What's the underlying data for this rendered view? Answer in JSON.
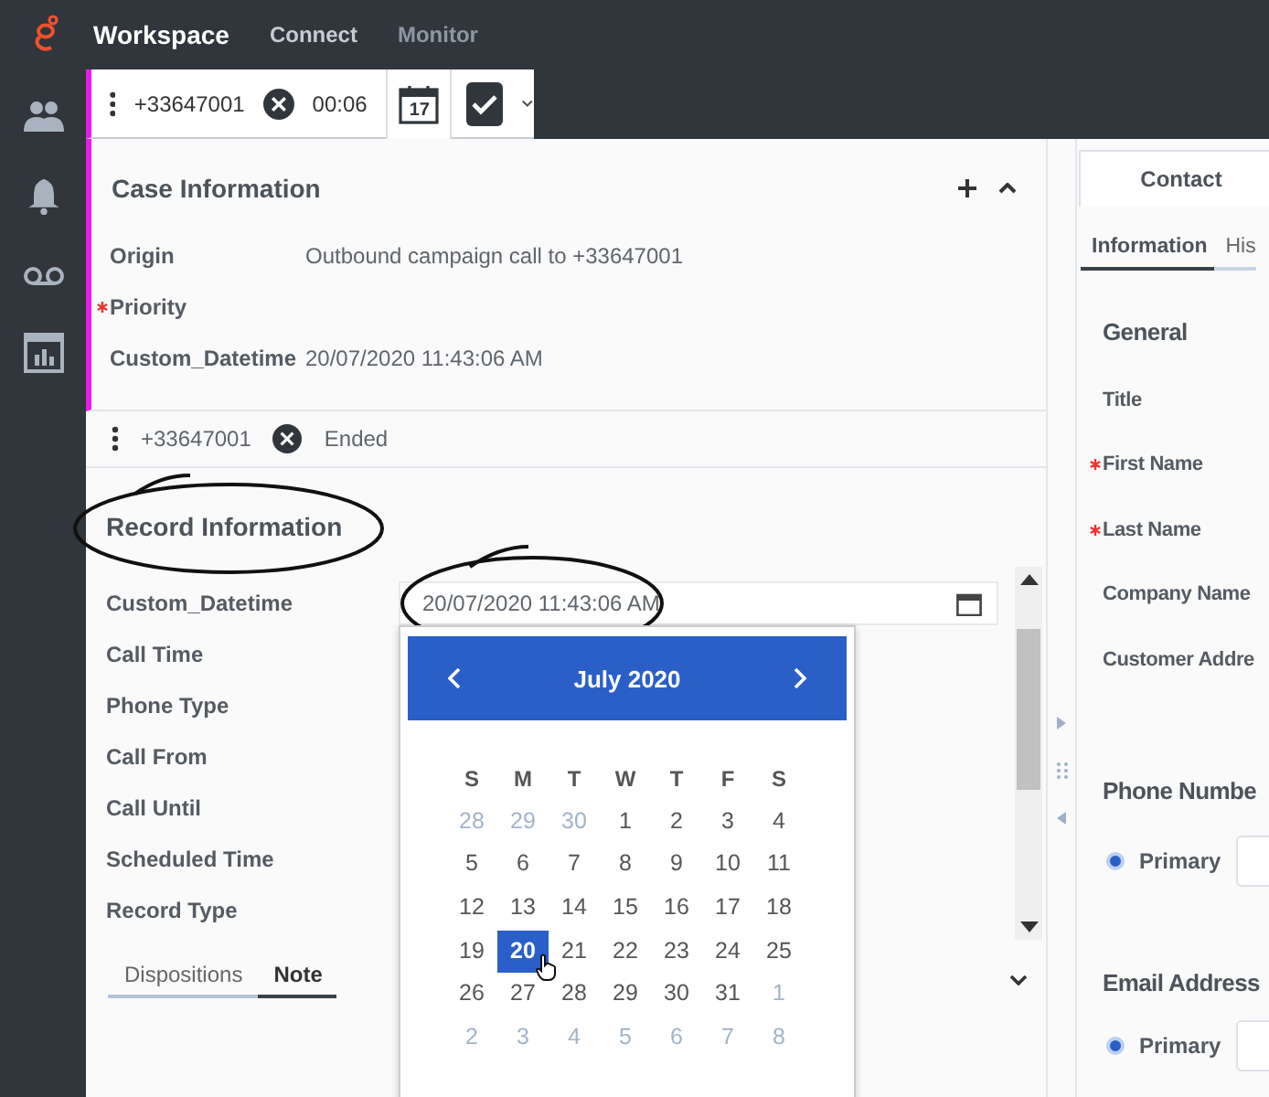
{
  "app": {
    "name": "Workspace",
    "nav": [
      {
        "label": "Connect",
        "selected": true
      },
      {
        "label": "Monitor",
        "selected": false
      }
    ]
  },
  "call_bar": {
    "number": "+33647001",
    "timer": "00:06",
    "calendar_day": "17"
  },
  "case_information": {
    "title": "Case Information",
    "fields": [
      {
        "label": "Origin",
        "value": "Outbound campaign call to +33647001",
        "required": false
      },
      {
        "label": "Priority",
        "required": true
      },
      {
        "label": "Custom_Datetime",
        "value": "20/07/2020 11:43:06 AM",
        "required": false
      }
    ]
  },
  "ended_call": {
    "number": "+33647001",
    "status": "Ended"
  },
  "record_information": {
    "title": "Record Information",
    "datetime_label": "Custom_Datetime",
    "datetime_value": "20/07/2020 11:43:06 AM",
    "fields": [
      "Call Time",
      "Phone Type",
      "Call From",
      "Call Until",
      "Scheduled Time",
      "Record Type"
    ],
    "tabs": [
      {
        "label": "Dispositions",
        "selected": false
      },
      {
        "label": "Note",
        "selected": true
      }
    ]
  },
  "date_picker": {
    "month": "July 2020",
    "weekdays": [
      "S",
      "M",
      "T",
      "W",
      "T",
      "F",
      "S"
    ],
    "weeks": [
      [
        {
          "day": "28",
          "outside": true,
          "selected": false
        },
        {
          "day": "29",
          "outside": true,
          "selected": false
        },
        {
          "day": "30",
          "outside": true,
          "selected": false
        },
        {
          "day": "1",
          "outside": false,
          "selected": false
        },
        {
          "day": "2",
          "outside": false,
          "selected": false
        },
        {
          "day": "3",
          "outside": false,
          "selected": false
        },
        {
          "day": "4",
          "outside": false,
          "selected": false
        }
      ],
      [
        {
          "day": "5",
          "outside": false,
          "selected": false
        },
        {
          "day": "6",
          "outside": false,
          "selected": false
        },
        {
          "day": "7",
          "outside": false,
          "selected": false
        },
        {
          "day": "8",
          "outside": false,
          "selected": false
        },
        {
          "day": "9",
          "outside": false,
          "selected": false
        },
        {
          "day": "10",
          "outside": false,
          "selected": false
        },
        {
          "day": "11",
          "outside": false,
          "selected": false
        }
      ],
      [
        {
          "day": "12",
          "outside": false,
          "selected": false
        },
        {
          "day": "13",
          "outside": false,
          "selected": false
        },
        {
          "day": "14",
          "outside": false,
          "selected": false
        },
        {
          "day": "15",
          "outside": false,
          "selected": false
        },
        {
          "day": "16",
          "outside": false,
          "selected": false
        },
        {
          "day": "17",
          "outside": false,
          "selected": false
        },
        {
          "day": "18",
          "outside": false,
          "selected": false
        }
      ],
      [
        {
          "day": "19",
          "outside": false,
          "selected": false
        },
        {
          "day": "20",
          "outside": false,
          "selected": true
        },
        {
          "day": "21",
          "outside": false,
          "selected": false
        },
        {
          "day": "22",
          "outside": false,
          "selected": false
        },
        {
          "day": "23",
          "outside": false,
          "selected": false
        },
        {
          "day": "24",
          "outside": false,
          "selected": false
        },
        {
          "day": "25",
          "outside": false,
          "selected": false
        }
      ],
      [
        {
          "day": "26",
          "outside": false,
          "selected": false
        },
        {
          "day": "27",
          "outside": false,
          "selected": false
        },
        {
          "day": "28",
          "outside": false,
          "selected": false
        },
        {
          "day": "29",
          "outside": false,
          "selected": false
        },
        {
          "day": "30",
          "outside": false,
          "selected": false
        },
        {
          "day": "31",
          "outside": false,
          "selected": false
        },
        {
          "day": "1",
          "outside": true,
          "selected": false
        }
      ],
      [
        {
          "day": "2",
          "outside": true,
          "selected": false
        },
        {
          "day": "3",
          "outside": true,
          "selected": false
        },
        {
          "day": "4",
          "outside": true,
          "selected": false
        },
        {
          "day": "5",
          "outside": true,
          "selected": false
        },
        {
          "day": "6",
          "outside": true,
          "selected": false
        },
        {
          "day": "7",
          "outside": true,
          "selected": false
        },
        {
          "day": "8",
          "outside": true,
          "selected": false
        }
      ]
    ]
  },
  "contact": {
    "tab": "Contact",
    "subtabs": [
      {
        "label": "Information",
        "selected": true
      },
      {
        "label": "His",
        "selected": false
      }
    ],
    "general_title": "General",
    "fields": [
      {
        "label": "Title",
        "required": false
      },
      {
        "label": "First Name",
        "required": true
      },
      {
        "label": "Last Name",
        "required": true
      },
      {
        "label": "Company Name",
        "required": false
      },
      {
        "label": "Customer Addre",
        "required": false
      }
    ],
    "phone_title": "Phone Numbe",
    "phone_primary": {
      "label": "Primary",
      "selected": true
    },
    "email_title": "Email Address",
    "email_primary": {
      "label": "Primary",
      "selected": true
    }
  }
}
